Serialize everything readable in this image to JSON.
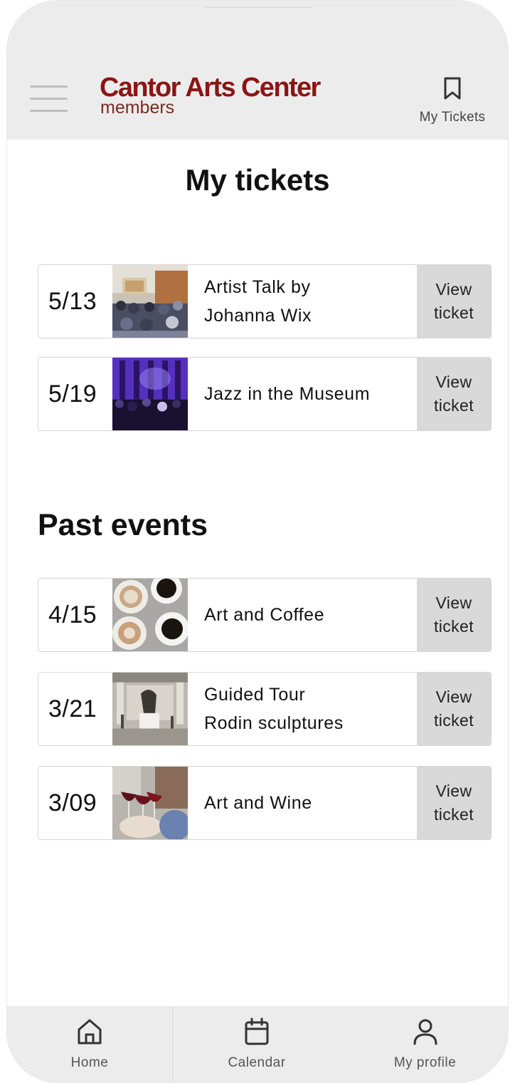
{
  "header": {
    "logo_name": "Cantor Arts Center",
    "logo_sub": "members",
    "tickets_label": "My Tickets"
  },
  "page_title": "My tickets",
  "upcoming": [
    {
      "date": "5/13",
      "title": "Artist Talk by\nJohanna Wix",
      "action": "View\nticket",
      "image": "lecture-audience-photo"
    },
    {
      "date": "5/19",
      "title": "Jazz in the Museum",
      "action": "View\nticket",
      "image": "jazz-concert-purple-lights-photo"
    }
  ],
  "past_title": "Past events",
  "past": [
    {
      "date": "4/15",
      "title": "Art and Coffee",
      "action": "View\nticket",
      "image": "coffee-cups-photo"
    },
    {
      "date": "3/21",
      "title": "Guided Tour\nRodin sculptures",
      "action": "View\nticket",
      "image": "rodin-gallery-photo"
    },
    {
      "date": "3/09",
      "title": "Art and Wine",
      "action": "View\nticket",
      "image": "wine-toast-photo"
    }
  ],
  "nav": {
    "home_label": "Home",
    "calendar_label": "Calendar",
    "profile_label": "My profile"
  },
  "colors": {
    "brand": "#8c1515",
    "header_bg": "#ececec",
    "button_bg": "#d9d9d9"
  }
}
